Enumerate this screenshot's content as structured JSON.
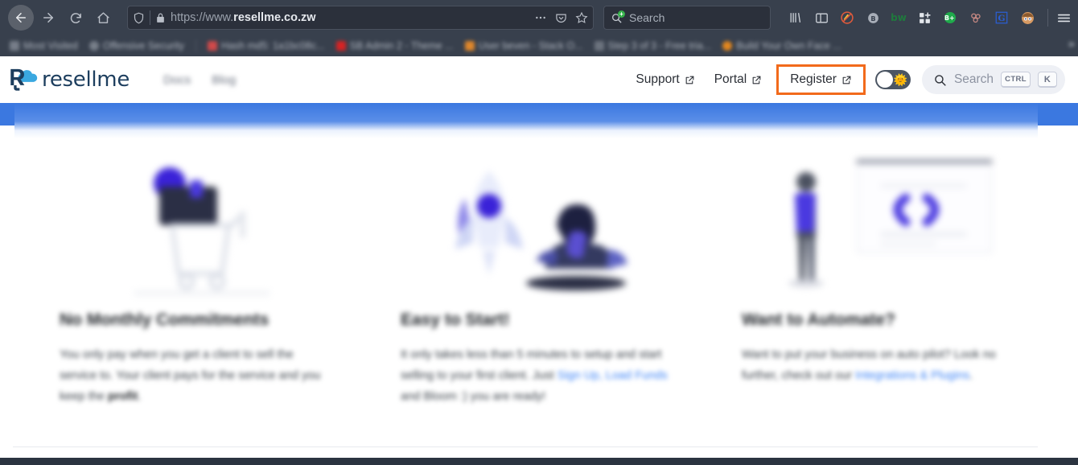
{
  "browser": {
    "nav": {
      "back": "back-arrow",
      "forward": "forward-arrow",
      "reload": "reload",
      "home": "home"
    },
    "urlbar": {
      "shield_icon": "tracking-protection-shield",
      "lock_icon": "padlock",
      "url_scheme": "https://www.",
      "url_domain": "resellme.co.zw",
      "full_url": "https://www.resellme.co.zw",
      "page_actions_icon": "ellipsis",
      "pocket_icon": "pocket",
      "bookmark_icon": "star"
    },
    "search": {
      "placeholder": "Search",
      "engine_icon": "search-magnifier-add"
    },
    "extensions": [
      {
        "name": "library-icon",
        "glyph": "||\\"
      },
      {
        "name": "sidebar-icon",
        "glyph": "▯"
      },
      {
        "name": "adblock-icon",
        "glyph": "⃠"
      },
      {
        "name": "bitwarden-b-icon",
        "glyph": "B"
      },
      {
        "name": "bitwarden-bw-icon",
        "glyph": "bw"
      },
      {
        "name": "grid-addon-icon",
        "glyph": "▞"
      },
      {
        "name": "bplus-icon",
        "glyph": "B+"
      },
      {
        "name": "molecule-icon",
        "glyph": "⦿"
      },
      {
        "name": "grammarly-g-icon",
        "glyph": "G"
      },
      {
        "name": "profile-avatar-icon",
        "glyph": "◕"
      }
    ],
    "menu_icon": "hamburger-menu",
    "bookmarks": [
      {
        "label": "Most Visited",
        "favicon": "gear"
      },
      {
        "label": "Offensive Security",
        "favicon": "globe"
      },
      {
        "label": "Hash md5: 1a1bc08c...",
        "favicon": "red-square"
      },
      {
        "label": "SB Admin 2 - Theme ...",
        "favicon": "red-s"
      },
      {
        "label": "User beven - Stack O...",
        "favicon": "orange-stack"
      },
      {
        "label": "Step 3 of 3 - Free tria...",
        "favicon": "grey-doc"
      },
      {
        "label": "Build Your Own Face ...",
        "favicon": "orange-circle"
      }
    ],
    "bookmarks_overflow": "»"
  },
  "site": {
    "brand": {
      "name": "resellme",
      "logo_icon": "r-cloud-logo",
      "color": "#1d3e5e"
    },
    "primary_nav": [
      {
        "label": "Docs"
      },
      {
        "label": "Blog"
      }
    ],
    "utility_nav": [
      {
        "label": "Support",
        "icon": "external-link-icon"
      },
      {
        "label": "Portal",
        "icon": "external-link-icon"
      },
      {
        "label": "Register",
        "icon": "external-link-icon",
        "highlighted": true,
        "highlight_color": "#f26a1b"
      }
    ],
    "theme_toggle": {
      "state": "light",
      "sun_glyph": "🌞"
    },
    "search": {
      "label": "Search",
      "icon": "search-icon",
      "shortcut_modifier": "CTRL",
      "shortcut_key": "K"
    },
    "banner": {
      "color": "#3b78e0"
    },
    "cards": [
      {
        "illustration": "shopping-cart-illustration",
        "title": "No Monthly Commitments",
        "body_before": "You only pay when you get a client to sell the service to. Your client pays for the service and you keep the ",
        "body_bold": "profit",
        "body_after": ".",
        "link_text": "",
        "link_tail": ""
      },
      {
        "illustration": "rocket-and-person-illustration",
        "title": "Easy to Start!",
        "body_before": "It only takes less than 5 minutes to setup and start selling to your first client. Just ",
        "body_bold": "",
        "link_text": "Sign Up, Load Funds",
        "body_after": " and Bloom :) you are ready!",
        "link_tail": ""
      },
      {
        "illustration": "person-and-code-window-illustration",
        "title": "Want to Automate?",
        "body_before": "Want to put your business on auto pilot? Look no further, check out our ",
        "body_bold": "",
        "link_text": "Integrations & Plugins",
        "body_after": ".",
        "link_tail": ""
      }
    ]
  }
}
